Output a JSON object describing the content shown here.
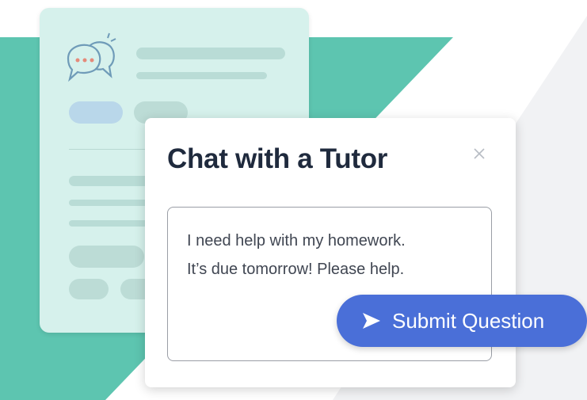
{
  "dialog": {
    "title": "Chat with a Tutor",
    "close_glyph": "×",
    "question_lines": [
      "I need help with my homework.",
      "It’s due tomorrow! Please help."
    ]
  },
  "submit": {
    "label": "Submit Question"
  },
  "colors": {
    "teal": "#5dc5b0",
    "card_bg": "#d6f1ec",
    "button": "#4a6fd8",
    "title": "#1f2a3d"
  },
  "icons": {
    "bubbles": "chat-bubbles-icon",
    "send": "send-icon",
    "close": "close-icon"
  }
}
